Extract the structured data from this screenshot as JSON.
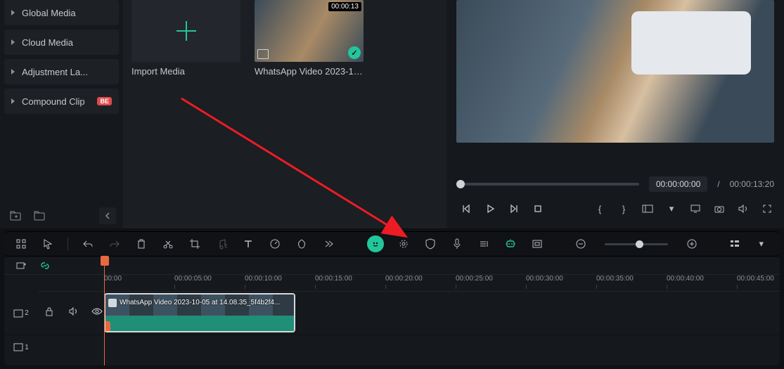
{
  "sidebar": {
    "items": [
      {
        "label": "Global Media"
      },
      {
        "label": "Cloud Media"
      },
      {
        "label": "Adjustment La..."
      },
      {
        "label": "Compound Clip",
        "badge": "BE"
      }
    ]
  },
  "media": {
    "import_label": "Import Media",
    "clip": {
      "label": "WhatsApp Video 2023-10-05...",
      "duration": "00:00:13"
    }
  },
  "preview": {
    "current": "00:00:00:00",
    "sep": "/",
    "total": "00:00:13:20"
  },
  "timeline": {
    "ticks": [
      "00:00",
      "00:00:05:00",
      "00:00:10:00",
      "00:00:15:00",
      "00:00:20:00",
      "00:00:25:00",
      "00:00:30:00",
      "00:00:35:00",
      "00:00:40:00",
      "00:00:45:00"
    ],
    "tracks": [
      {
        "id": "2"
      },
      {
        "id": "1"
      }
    ],
    "clip_label": "WhatsApp Video 2023-10-05 at 14.08.35_5f4b2f4..."
  }
}
